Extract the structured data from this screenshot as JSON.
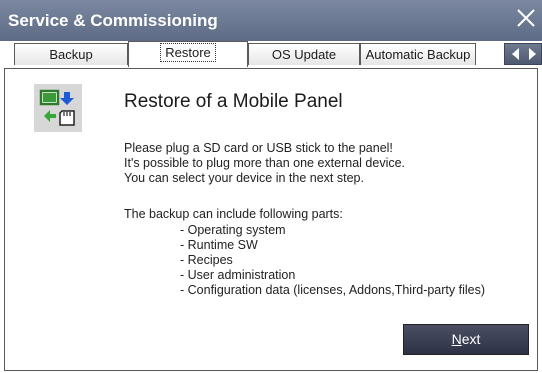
{
  "window": {
    "title": "Service & Commissioning"
  },
  "tabs": [
    {
      "label": "Backup"
    },
    {
      "label": "Restore"
    },
    {
      "label": "OS Update"
    },
    {
      "label": "Automatic Backup"
    }
  ],
  "content": {
    "heading": "Restore of a Mobile Panel",
    "intro_lines": [
      "Please plug a SD card or USB stick to the panel!",
      "It's possible to plug more than one external device.",
      "You can select your device in the next step."
    ],
    "parts_intro": "The backup can include following parts:",
    "parts": [
      "- Operating system",
      "- Runtime SW",
      "- Recipes",
      "- User administration",
      "- Configuration data (licenses, Addons,Third-party files)"
    ]
  },
  "buttons": {
    "next_first": "N",
    "next_rest": "ext"
  },
  "icons": {
    "close": "close-icon",
    "tab_left": "arrow-left-icon",
    "tab_right": "arrow-right-icon",
    "restore": "restore-device-icon"
  },
  "colors": {
    "titlebar": "#6b7893",
    "button": "#3b3f54"
  }
}
